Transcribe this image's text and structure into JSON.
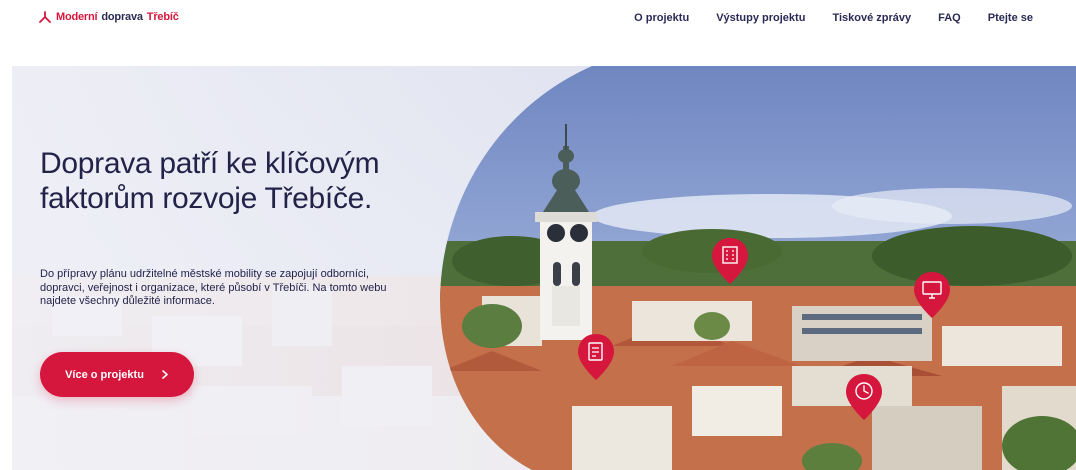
{
  "header": {
    "logo": {
      "part1": "Moderní",
      "part2": "doprava",
      "part3": "Třebíč"
    },
    "nav": [
      {
        "label": "O projektu"
      },
      {
        "label": "Výstupy projektu"
      },
      {
        "label": "Tiskové zprávy"
      },
      {
        "label": "FAQ"
      },
      {
        "label": "Ptejte se"
      }
    ]
  },
  "hero": {
    "title": "Doprava patří ke klíčovým faktorům rozvoje Třebíče.",
    "description": "Do přípravy plánu udržitelné městské mobility se zapojují odborníci, dopravci, veřejnost i organizace, které působí v Třebíči. Na tomto webu najdete všechny důležité informace.",
    "cta_label": "Více o projektu"
  },
  "colors": {
    "accent": "#d6173d",
    "text": "#23234a",
    "sky": "#7d92c8"
  },
  "icons": [
    "logo-figure-icon",
    "chevron-right-icon",
    "building-pin-icon",
    "document-pin-icon",
    "monitor-pin-icon",
    "clock-pin-icon"
  ]
}
